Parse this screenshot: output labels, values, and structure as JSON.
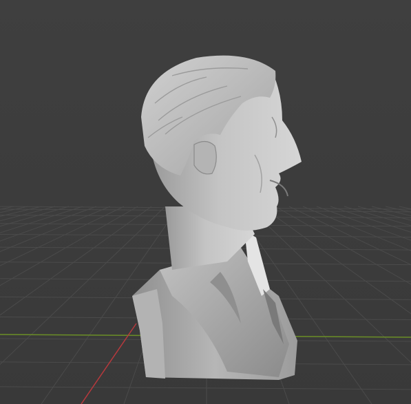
{
  "viewport": {
    "background": "#3d3d3d",
    "grid_color": "#555555",
    "x_axis_color": "#b8393d",
    "y_axis_color": "#6b8f26"
  },
  "scene": {
    "object_icon": "bust-mesh-icon",
    "material_light": "#c9c9c9",
    "material_mid": "#a8a8a8",
    "material_dark": "#6f6f6f"
  }
}
